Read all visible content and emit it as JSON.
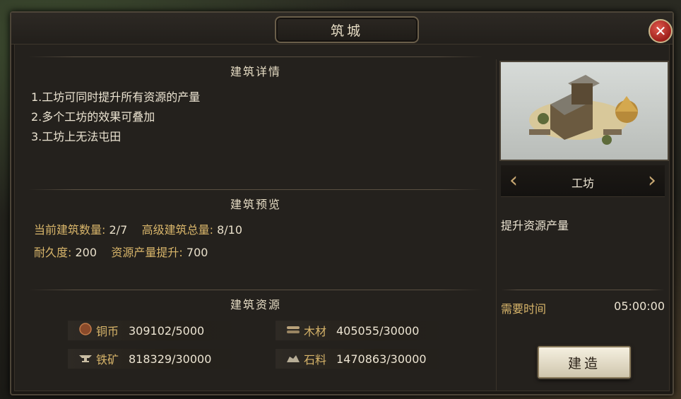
{
  "dialog": {
    "title": "筑城",
    "close_icon": "close-icon"
  },
  "details": {
    "heading": "建筑详情",
    "lines": [
      "1.工坊可同时提升所有资源的产量",
      "2.多个工坊的效果可叠加",
      "3.工坊上无法屯田"
    ]
  },
  "preview": {
    "heading": "建筑预览",
    "current_count_label": "当前建筑数量:",
    "current_count_value": "2/7",
    "advanced_total_label": "高级建筑总量:",
    "advanced_total_value": "8/10",
    "durability_label": "耐久度:",
    "durability_value": "200",
    "boost_label": "资源产量提升:",
    "boost_value": "700"
  },
  "resources": {
    "heading": "建筑资源",
    "items": [
      {
        "icon": "copper-coin-icon",
        "label": "铜币",
        "value": "309102/5000"
      },
      {
        "icon": "wood-icon",
        "label": "木材",
        "value": "405055/30000"
      },
      {
        "icon": "iron-anvil-icon",
        "label": "铁矿",
        "value": "818329/30000"
      },
      {
        "icon": "stone-icon",
        "label": "石料",
        "value": "1470863/30000"
      }
    ]
  },
  "building": {
    "name": "工坊",
    "description": "提升资源产量",
    "time_label": "需要时间",
    "time_value": "05:00:00",
    "build_label": "建造"
  },
  "colors": {
    "gold_label": "#d8b56a",
    "text": "#ece4d2",
    "panel": "#24211d"
  }
}
